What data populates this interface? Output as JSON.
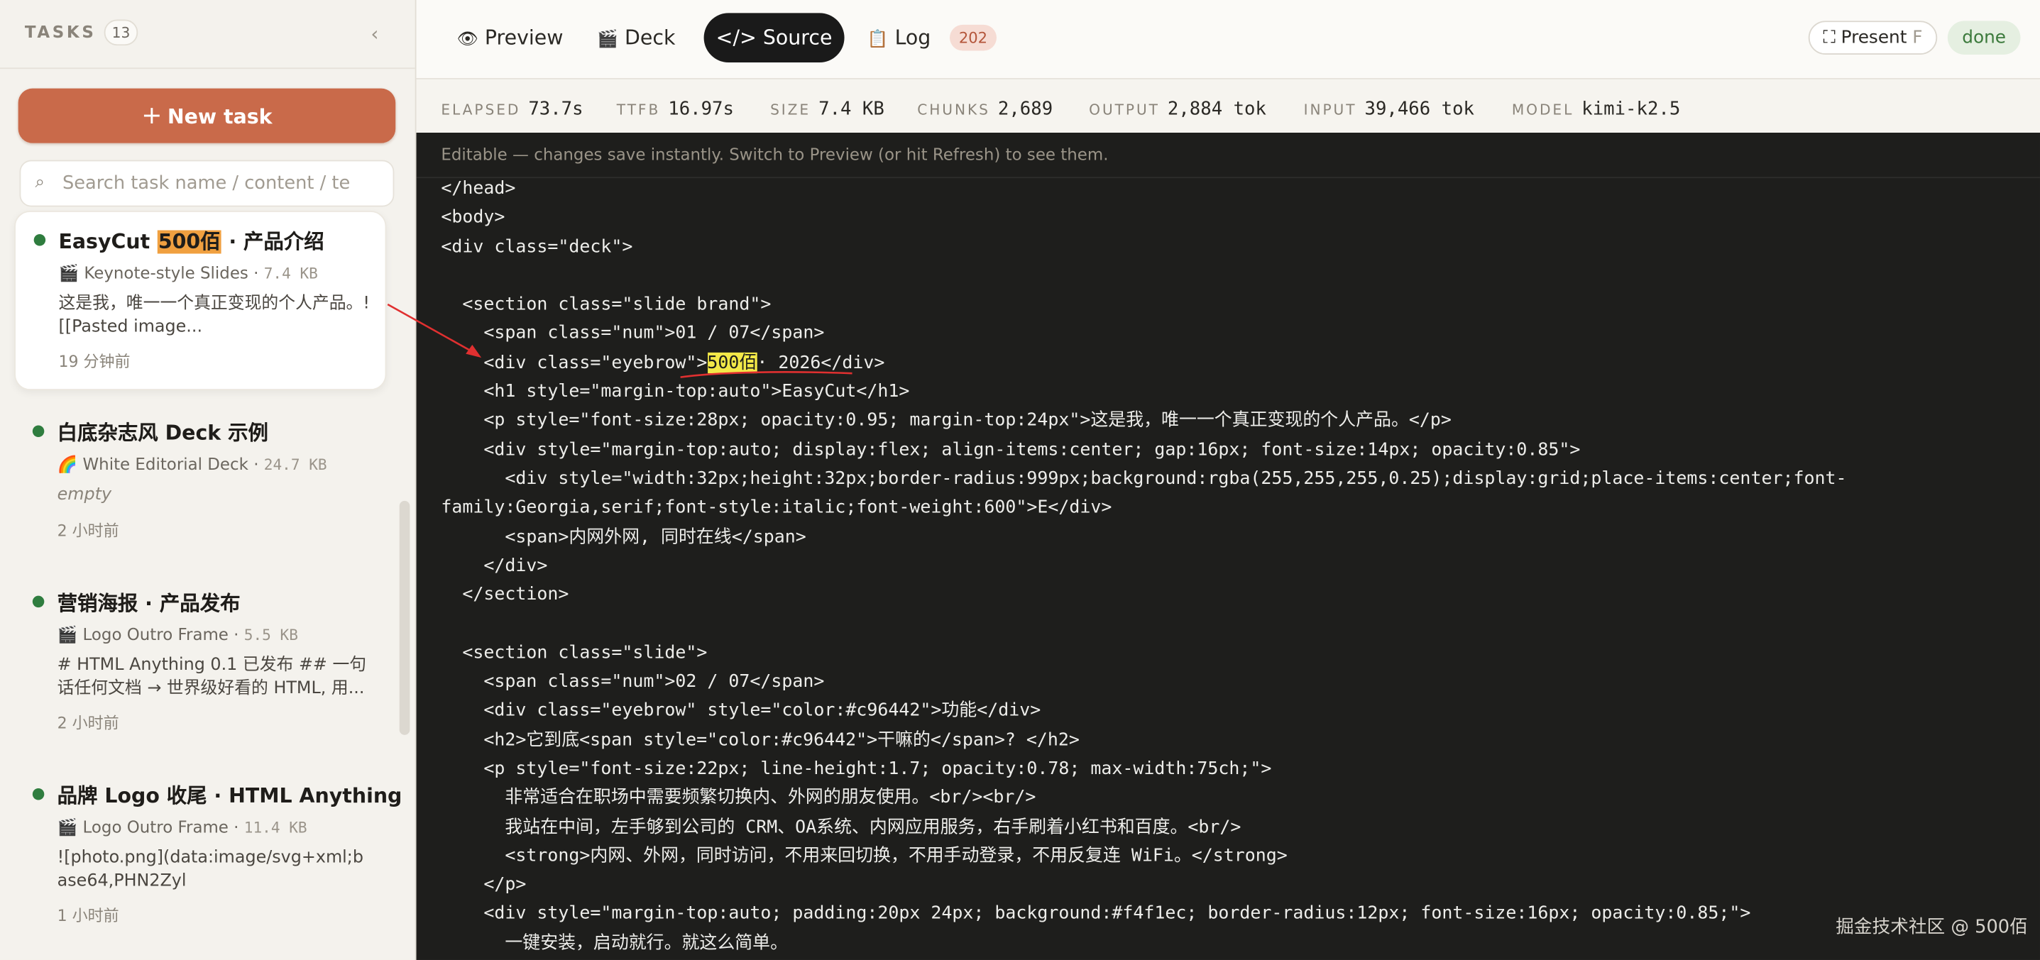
{
  "sidebar": {
    "title": "TASKS",
    "count": "13",
    "new_task_label": "New task",
    "search_placeholder": "Search task name / content / te",
    "tasks": [
      {
        "name_prefix": "EasyCut ",
        "name_highlight": "500佰",
        "name_suffix": " · 产品介绍",
        "icon": "🎬",
        "type": "Keynote-style Slides",
        "size": "7.4 KB",
        "desc": "这是我，唯一一个真正变现的个人产品。![[Pasted image...",
        "time": "19 分钟前"
      },
      {
        "name": "白底杂志风 Deck 示例",
        "icon": "🌈",
        "type": "White Editorial Deck",
        "size": "24.7 KB",
        "desc": "empty",
        "time": "2 小时前"
      },
      {
        "name": "营销海报 · 产品发布",
        "icon": "🎬",
        "type": "Logo Outro Frame",
        "size": "5.5 KB",
        "desc": "# HTML Anything 0.1 已发布 ## 一句话任何文档 → 世界级好看的 HTML, 用...",
        "time": "2 小时前"
      },
      {
        "name": "品牌 Logo 收尾 · HTML Anything",
        "icon": "🎬",
        "type": "Logo Outro Frame",
        "size": "11.4 KB",
        "desc": "![photo.png](data:image/svg+xml;base64,PHN2Zyl",
        "time": "1 小时前"
      }
    ]
  },
  "tabs": {
    "preview": "Preview",
    "deck": "Deck",
    "source": "</> Source",
    "log": "Log",
    "log_count": "202"
  },
  "present": {
    "label": "Present",
    "shortcut": "F"
  },
  "status": "done",
  "stats": [
    {
      "key": "ELAPSED",
      "value": "73.7s"
    },
    {
      "key": "TTFB",
      "value": "16.97s"
    },
    {
      "key": "SIZE",
      "value": "7.4 KB"
    },
    {
      "key": "CHUNKS",
      "value": "2,689"
    },
    {
      "key": "OUTPUT",
      "value": "2,884 tok"
    },
    {
      "key": "INPUT",
      "value": "39,466 tok"
    },
    {
      "key": "MODEL",
      "value": "kimi-k2.5"
    }
  ],
  "editor": {
    "hint": "Editable — changes save instantly. Switch to Preview (or hit Refresh) to see them.",
    "lines": [
      "</head>",
      "<body>",
      "<div class=\"deck\">",
      "",
      "  <section class=\"slide brand\">",
      "    <span class=\"num\">01 / 07</span>",
      {
        "pre": "    <div class=\"eyebrow\">",
        "mark": "500佰",
        "post": "· 2026</div>"
      },
      "    <h1 style=\"margin-top:auto\">EasyCut</h1>",
      "    <p style=\"font-size:28px; opacity:0.95; margin-top:24px\">这是我，唯一一个真正变现的个人产品。</p>",
      "    <div style=\"margin-top:auto; display:flex; align-items:center; gap:16px; font-size:14px; opacity:0.85\">",
      "      <div style=\"width:32px;height:32px;border-radius:999px;background:rgba(255,255,255,0.25);display:grid;place-items:center;font-",
      "family:Georgia,serif;font-style:italic;font-weight:600\">E</div>",
      "      <span>内网外网, 同时在线</span>",
      "    </div>",
      "  </section>",
      "",
      "  <section class=\"slide\">",
      "    <span class=\"num\">02 / 07</span>",
      "    <div class=\"eyebrow\" style=\"color:#c96442\">功能</div>",
      "    <h2>它到底<span style=\"color:#c96442\">干嘛的</span>? </h2>",
      "    <p style=\"font-size:22px; line-height:1.7; opacity:0.78; max-width:75ch;\">",
      "      非常适合在职场中需要频繁切换内、外网的朋友使用。<br/><br/>",
      "      我站在中间，左手够到公司的 CRM、OA系统、内网应用服务，右手刷着小红书和百度。<br/>",
      "      <strong>内网、外网，同时访问，不用来回切换，不用手动登录，不用反复连 WiFi。</strong>",
      "    </p>",
      "    <div style=\"margin-top:auto; padding:20px 24px; background:#f4f1ec; border-radius:12px; font-size:16px; opacity:0.85;\">",
      "      一键安装，启动就行。就这么简单。"
    ]
  },
  "watermark": "掘金技术社区 @ 500佰",
  "colors": {
    "accent": "#c96a4a",
    "status_done_bg": "#e5efe1",
    "status_done_text": "#3c7a3c",
    "editor_bg": "#1e1e1c",
    "highlight": "#f3e948",
    "annotation": "#e03030"
  }
}
